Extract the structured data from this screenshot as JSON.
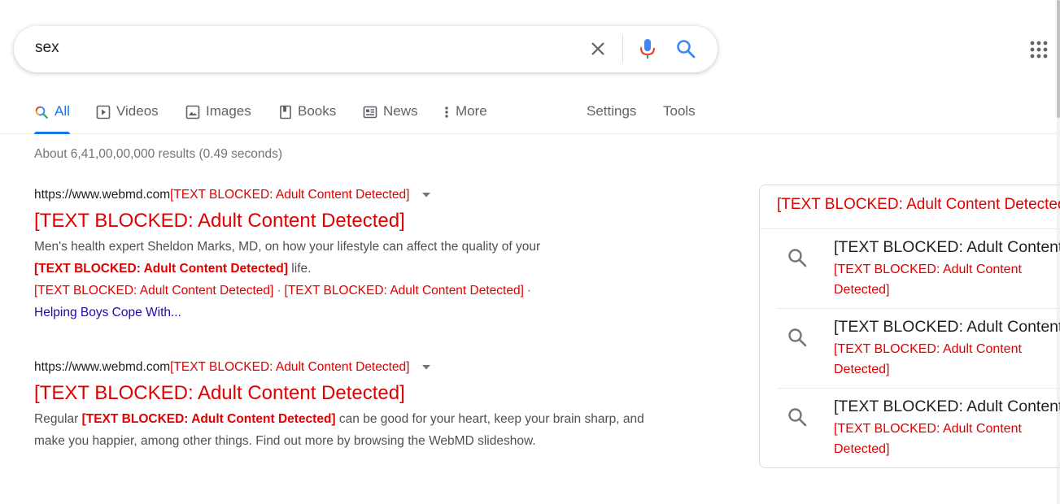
{
  "search": {
    "query": "sex"
  },
  "tabs": [
    {
      "label": "All",
      "icon": "search-icon",
      "active": true
    },
    {
      "label": "Videos",
      "icon": "play-icon"
    },
    {
      "label": "Images",
      "icon": "image-icon"
    },
    {
      "label": "Books",
      "icon": "book-icon"
    },
    {
      "label": "News",
      "icon": "news-icon"
    },
    {
      "label": "More",
      "icon": "more-vert-icon"
    }
  ],
  "tools": {
    "settings": "Settings",
    "tools": "Tools"
  },
  "stats": "About 6,41,00,00,000 results (0.49 seconds)",
  "results": [
    {
      "url": "https://www.webmd.com",
      "url_blocked": "[TEXT BLOCKED: Adult Content Detected]",
      "title": "[TEXT BLOCKED: Adult Content Detected]",
      "snippet_1": "Men's health expert Sheldon Marks, MD, on how your lifestyle can affect the quality of your",
      "snippet_bold": "[TEXT BLOCKED: Adult Content Detected]",
      "snippet_2": " life.",
      "sitelink_1": "[TEXT BLOCKED: Adult Content Detected]",
      "sitelink_2": "[TEXT BLOCKED: Adult Content Detected]",
      "sitelink_sep": "·",
      "sitelink_3": "Helping Boys Cope With..."
    },
    {
      "url": "https://www.webmd.com",
      "url_blocked": "[TEXT BLOCKED: Adult Content Detected]",
      "title": "[TEXT BLOCKED: Adult Content Detected]",
      "snippet_pre": "Regular ",
      "snippet_bold": "[TEXT BLOCKED: Adult Content Detected]",
      "snippet_post": " can be good for your heart, keep your brain sharp, and make you happier, among other things. Find out more by browsing the WebMD slideshow."
    }
  ],
  "panel": {
    "header": "[TEXT BLOCKED: Adult Content Detected]",
    "items": [
      {
        "title": "[TEXT BLOCKED: Adult Content Detected]",
        "subtitle": "[TEXT BLOCKED: Adult Content Detected]"
      },
      {
        "title": "[TEXT BLOCKED: Adult Content Detected]",
        "subtitle": "[TEXT BLOCKED: Adult Content Detected]"
      },
      {
        "title": "[TEXT BLOCKED: Adult Content Detected]",
        "subtitle": "[TEXT BLOCKED: Adult Content Detected]"
      }
    ]
  },
  "colors": {
    "blocked_red": "#e00000",
    "link_blue": "#1a0dab",
    "active_tab": "#1a73e8"
  }
}
